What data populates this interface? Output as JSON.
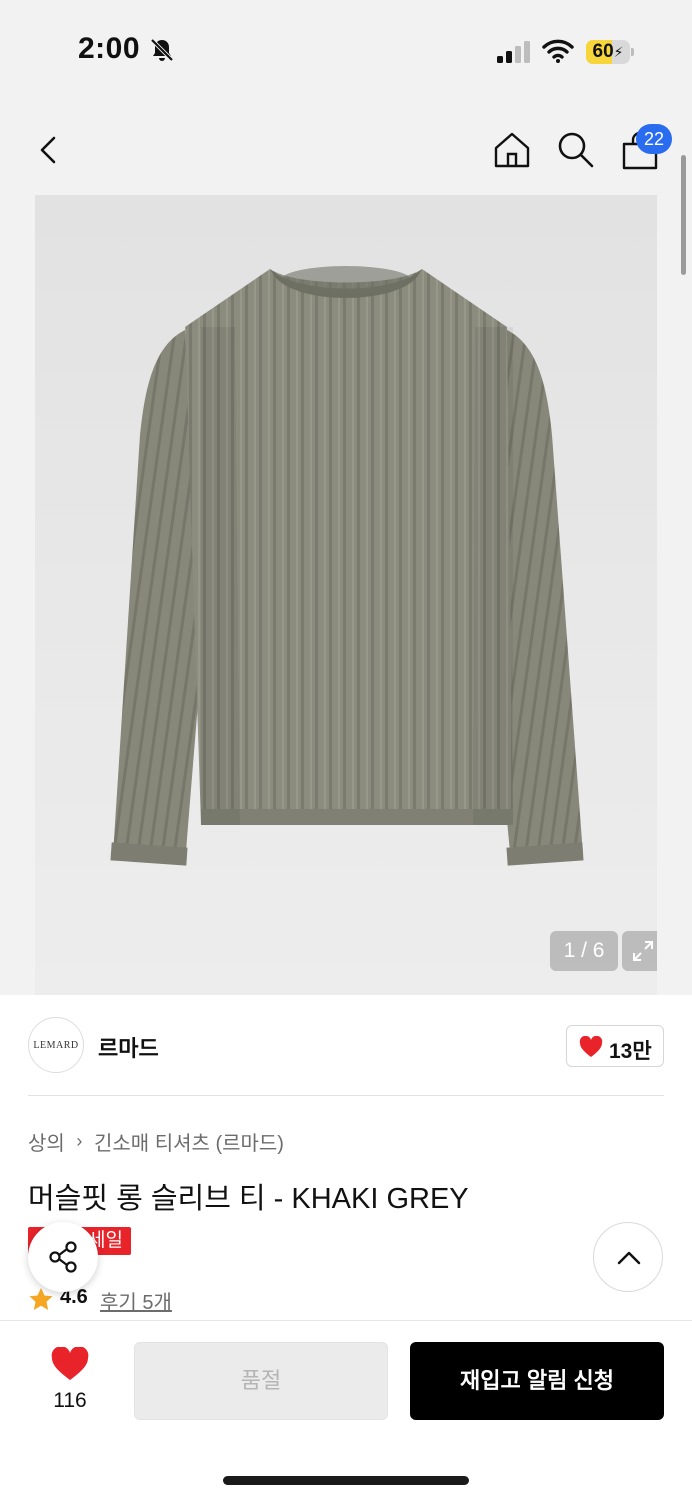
{
  "status_bar": {
    "time": "2:00",
    "battery_percent": "60",
    "battery_level": 0.6,
    "icons": [
      "bell-slash-icon",
      "cellular-signal-icon",
      "wifi-icon",
      "battery-charging-icon"
    ]
  },
  "nav": {
    "icons": [
      "back-arrow-icon",
      "home-icon",
      "search-icon",
      "shopping-bag-icon"
    ],
    "cart_count": "22"
  },
  "gallery": {
    "page_indicator": "1 / 6",
    "expand_icon": "expand-icon"
  },
  "brand": {
    "logo_text": "LEMARD",
    "name": "르마드",
    "like_count": "13만",
    "like_icon": "heart-icon",
    "like_color": "#e8232a"
  },
  "product": {
    "breadcrumb": [
      "상의",
      "긴소매 티셔츠 (르마드)"
    ],
    "title": "머슬핏 롱 슬리브 티 - KHAKI GREY",
    "sale_badge_visible": "세일",
    "rating": "4.6",
    "review_text": "후기 5개",
    "star_color": "#f5a623"
  },
  "floating": {
    "share_icon": "share-icon",
    "top_icon": "chevron-up-icon"
  },
  "bottom_bar": {
    "wish_count": "116",
    "wish_icon": "heart-icon",
    "soldout_label": "품절",
    "restock_label": "재입고 알림 신청",
    "accent_color": "#000000"
  }
}
